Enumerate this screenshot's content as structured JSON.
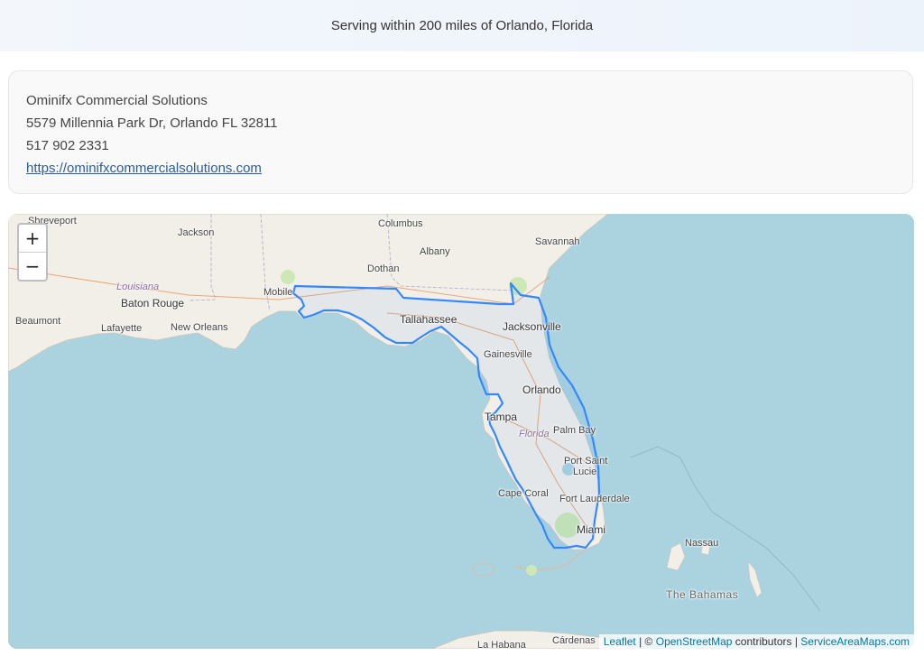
{
  "header": {
    "title": "Serving within 200 miles of Orlando, Florida"
  },
  "business": {
    "name": "Ominifx Commercial Solutions",
    "address": "5579 Millennia Park Dr, Orlando FL 32811",
    "phone": "517 902 2331",
    "website": "https://ominifxcommercialsolutions.com"
  },
  "map": {
    "zoom_in_label": "+",
    "zoom_out_label": "−",
    "labels": {
      "shreveport": "Shreveport",
      "jackson": "Jackson",
      "columbus": "Columbus",
      "albany": "Albany",
      "savannah": "Savannah",
      "dothan": "Dothan",
      "louisiana": "Louisiana",
      "baton_rouge": "Baton Rouge",
      "mobile": "Mobile",
      "beaumont": "Beaumont",
      "lafayette": "Lafayette",
      "new_orleans": "New Orleans",
      "tallahassee": "Tallahassee",
      "jacksonville": "Jacksonville",
      "gainesville": "Gainesville",
      "orlando": "Orlando",
      "tampa": "Tampa",
      "florida": "Florida",
      "palm_bay": "Palm Bay",
      "port_saint_lucie_1": "Port Saint",
      "port_saint_lucie_2": "Lucie",
      "cape_coral": "Cape Coral",
      "fort_lauderdale": "Fort Lauderdale",
      "miami": "Miami",
      "nassau": "Nassau",
      "bahamas": "The Bahamas",
      "la_habana": "La Habana",
      "cardenas": "Cárdenas"
    },
    "attribution": {
      "leaflet": "Leaflet",
      "sep1": " | © ",
      "osm": "OpenStreetMap",
      "contrib": " contributors | ",
      "sam": "ServiceAreaMaps.com"
    },
    "colors": {
      "water": "#aad3df",
      "land": "#f2efe9",
      "service_area_stroke": "#3388ff"
    }
  }
}
